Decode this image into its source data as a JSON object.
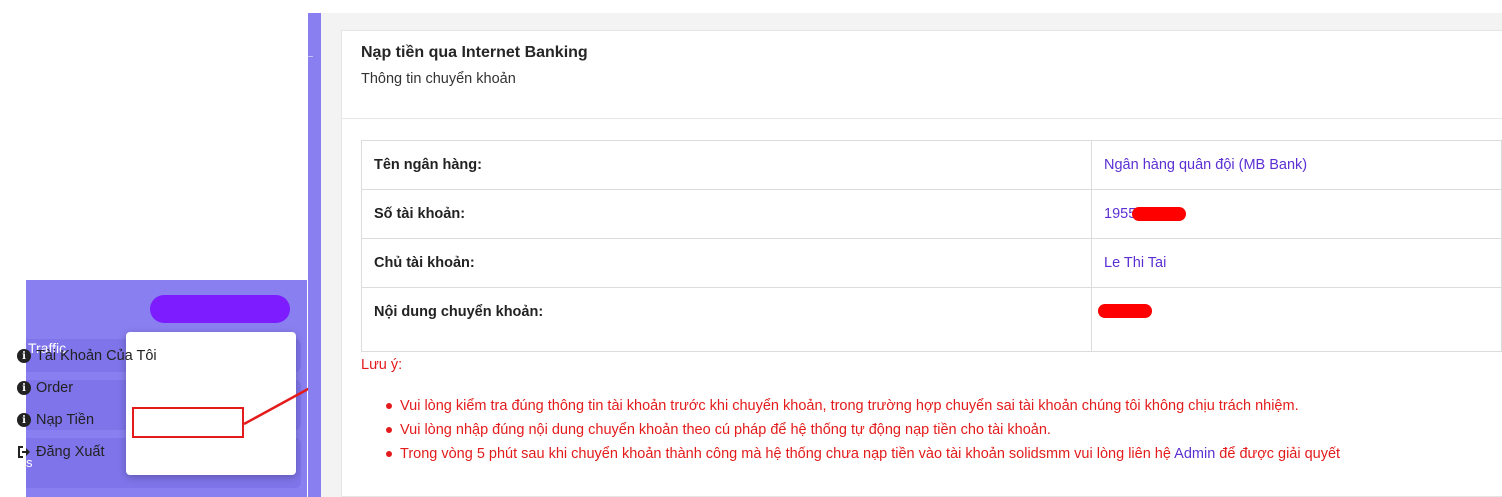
{
  "left_menu": {
    "traffic_label": "Traffic",
    "bottom_letter": "s",
    "dropdown": [
      {
        "label": "Tài Khoản Của Tôi",
        "icon": "info-circle-icon"
      },
      {
        "label": "Order",
        "icon": "info-circle-icon"
      },
      {
        "label": "Nạp Tiền",
        "icon": "info-circle-icon"
      },
      {
        "label": "Đăng Xuất",
        "icon": "sign-out-icon"
      }
    ],
    "highlight_color": "#e31b1b",
    "accent_color": "#8a7ff0"
  },
  "card": {
    "title": "Nạp tiền qua Internet Banking",
    "subtitle": "Thông tin chuyển khoản",
    "rows": [
      {
        "label": "Tên ngân hàng:",
        "value": "Ngân hàng quân đội (MB Bank)"
      },
      {
        "label": "Số tài khoản:",
        "value": "1955"
      },
      {
        "label": "Chủ tài khoản:",
        "value": "Le Thi Tai"
      },
      {
        "label": "Nội dung chuyển khoản:",
        "value": ""
      }
    ],
    "note_title": "Lưu ý:",
    "notes": {
      "n1": "Vui lòng kiểm tra đúng thông tin tài khoản trước khi chuyển khoản, trong trường hợp chuyển sai tài khoản chúng tôi không chịu trách nhiệm.",
      "n2": "Vui lòng nhập đúng nội dung chuyển khoản theo cú pháp để hệ thống tự động nạp tiền cho tài khoản.",
      "n3_before": "Trong vòng 5 phút sau khi chuyển khoản thành công mà hệ thống chưa nạp tiền vào tài khoản solidsmm vui lòng liên hệ ",
      "n3_link": "Admin",
      "n3_after": " để được giải quyết"
    },
    "value_color": "#5b2fd3",
    "note_color": "#e31b1b"
  }
}
